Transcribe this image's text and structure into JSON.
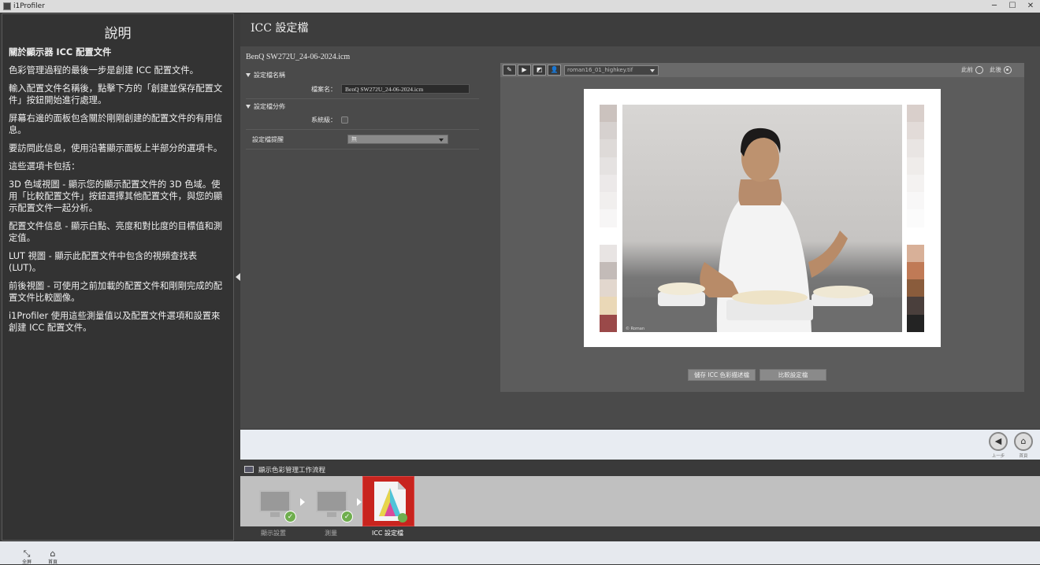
{
  "window": {
    "title": "i1Profiler",
    "minimize": "─",
    "maximize": "☐",
    "close": "✕"
  },
  "help": {
    "title": "說明",
    "heading": "關於顯示器 ICC 配置文件",
    "paragraphs": [
      "色彩管理過程的最後一步是創建 ICC 配置文件。",
      "輸入配置文件名稱後，點擊下方的「創建並保存配置文件」按鈕開始進行處理。",
      "屏幕右邊的面板包含關於剛剛創建的配置文件的有用信息。",
      "要訪問此信息，使用沿著顯示面板上半部分的選項卡。",
      "這些選項卡包括：",
      "3D 色域視圖 - 顯示您的顯示配置文件的 3D 色域。使用「比較配置文件」按鈕選擇其他配置文件，與您的顯示配置文件一起分析。",
      "配置文件信息 - 顯示白點、亮度和對比度的目標值和測定值。",
      "LUT 視圖 - 顯示此配置文件中包含的視頻查找表 (LUT)。",
      "前後視圖 - 可使用之前加載的配置文件和剛剛完成的配置文件比較圖像。",
      "i1Profiler 使用這些測量值以及配置文件選項和設置來創建 ICC 配置文件。"
    ]
  },
  "main": {
    "title": "ICC 設定檔",
    "profile_filename": "BenQ SW272U_24-06-2024.icm",
    "section_name": "設定檔名稱",
    "filename_label": "檔案名：",
    "filename_value": "BenQ SW272U_24-06-2024.icm",
    "section_dist": "設定檔分佈",
    "system_label": "系統級：",
    "reminder_label": "設定檔提醒",
    "reminder_value": "無"
  },
  "preview": {
    "tools": [
      "✎",
      "▶",
      "◩",
      "👤"
    ],
    "image_select": "roman16_01_highkey.tif",
    "before_label": "此前",
    "after_label": "此後",
    "selected": "after",
    "photo_credit": "© Roman",
    "save_button": "儲存 ICC 色彩描述檔",
    "compare_button": "比較設定檔",
    "swatches_left": [
      "#cbc2be",
      "#d6d1cf",
      "#dedad8",
      "#e5e2e1",
      "#ece9e9",
      "#f1efee",
      "#f7f6f6",
      "#ffffff",
      "#e8e4e3",
      "#c3bbb8",
      "#e2d7ce",
      "#ead8b7",
      "#9a4949"
    ],
    "swatches_right": [
      "#d9cfcb",
      "#e2dbd8",
      "#e9e5e3",
      "#efecea",
      "#f4f2f1",
      "#f8f7f7",
      "#fbfbfb",
      "#ffffff",
      "#d8b098",
      "#c07a56",
      "#8a5c3c",
      "#4a3f3c",
      "#232323"
    ]
  },
  "nav": {
    "back_label": "上一步",
    "home_label": "首頁",
    "back_icon": "◀",
    "home_icon": "⌂"
  },
  "workflow": {
    "title": "顯示色彩管理工作流程",
    "steps": [
      "顯示設置",
      "測量",
      "ICC 設定檔"
    ]
  },
  "bottom": {
    "fullscreen_label": "全屏",
    "home_label": "首頁",
    "fullscreen_icon": "⤡",
    "home_icon": "⌂"
  }
}
